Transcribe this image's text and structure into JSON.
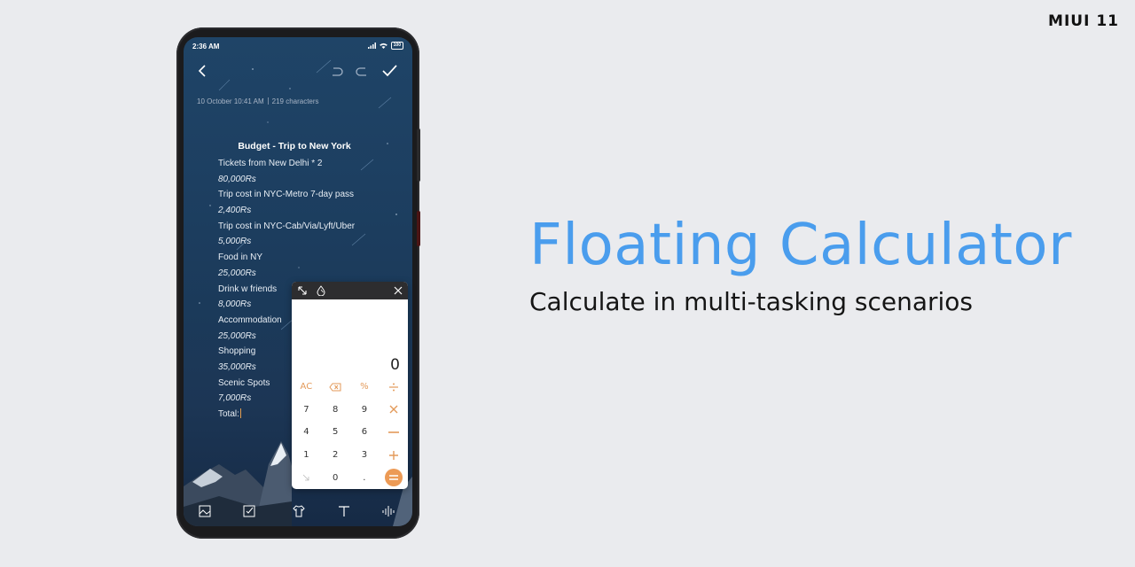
{
  "brand": "MIUI 11",
  "headline": "Floating Calculator",
  "subheadline": "Calculate in multi-tasking scenarios",
  "colors": {
    "accent": "#4a9ded",
    "calc_accent": "#ec9a55",
    "cursor": "#e39d4f"
  },
  "phone": {
    "status": {
      "time": "2:36 AM",
      "battery": "100"
    },
    "note_meta": {
      "date": "10 October",
      "time": "10:41 AM",
      "chars": "219 characters"
    },
    "note": {
      "title": "Budget - Trip to New York",
      "lines": [
        "Tickets from New Delhi * 2",
        "80,000Rs",
        "Trip cost in NYC-Metro 7-day pass",
        "2,400Rs",
        "Trip cost in NYC-Cab/Via/Lyft/Uber",
        "5,000Rs",
        "Food in NY",
        "25,000Rs",
        "Drink w friends",
        "8,000Rs",
        "Accommodation",
        "25,000Rs",
        "Shopping",
        "35,000Rs",
        "Scenic Spots",
        "7,000Rs",
        "Total:"
      ]
    },
    "toolbar_icons": [
      "image-icon",
      "checklist-icon",
      "theme-shirt-icon",
      "text-format-icon",
      "audio-icon"
    ]
  },
  "calculator": {
    "display": "0",
    "keys": {
      "ac": "AC",
      "percent": "%",
      "k7": "7",
      "k8": "8",
      "k9": "9",
      "k4": "4",
      "k5": "5",
      "k6": "6",
      "k1": "1",
      "k2": "2",
      "k3": "3",
      "k0": "0",
      "dot": "."
    }
  }
}
